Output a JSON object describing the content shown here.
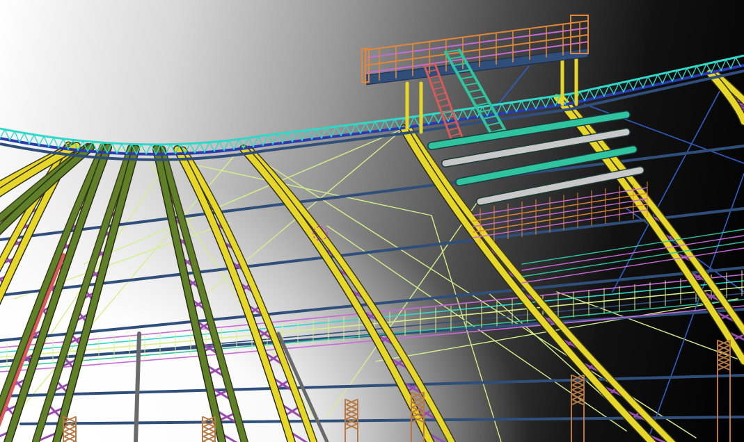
{
  "scene": {
    "description_free": true,
    "colors": {
      "chord_yellow": "#e6d62a",
      "chord_green": "#5f7f28",
      "web_purple": "#9a4bb0",
      "purlin_blue": "#2f4f7a",
      "cable_lightgreen": "#d9ee8a",
      "ring_cyan": "#2fd8c8",
      "ring_blue": "#2a3bb0",
      "rail_orange": "#e0873a",
      "rail_magenta": "#c86ad8",
      "stair_teal": "#2fc3a0",
      "brace_red": "#d85a5a",
      "col_brown": "#b77a45",
      "blue_brace": "#2f5fc8"
    }
  }
}
